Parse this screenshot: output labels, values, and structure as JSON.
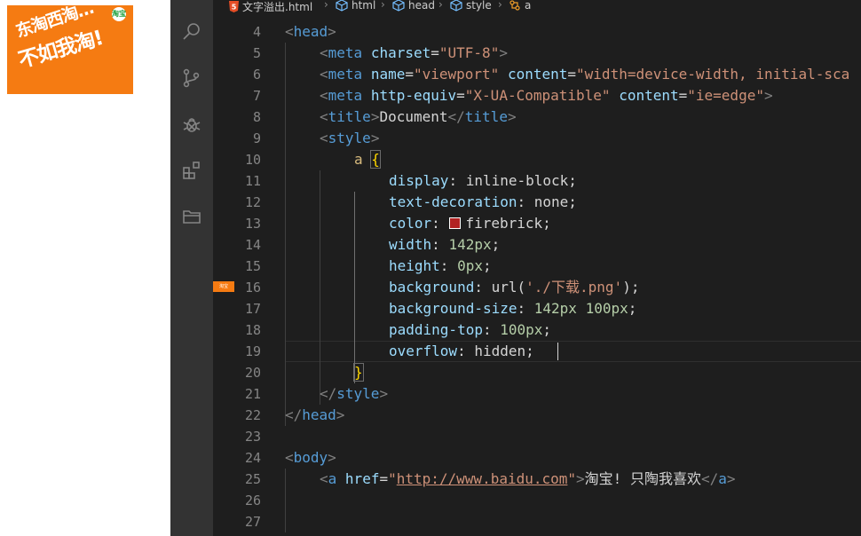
{
  "preview": {
    "logo_line1": "东淘西淘…",
    "logo_line2": "不如我淘!",
    "logo_badge": "淘宝"
  },
  "activity_bar": {
    "icons": [
      "search-icon",
      "source-control-icon",
      "debug-icon",
      "extensions-icon",
      "explorer-icon"
    ]
  },
  "breadcrumb": {
    "file": "文字溢出.html",
    "items": [
      "html",
      "head",
      "style",
      "a"
    ]
  },
  "gutter_thumbnail": "淘宝",
  "colors": {
    "swatch": "#b22222",
    "logo_bg": "#f57b12",
    "editor_bg": "#1e1e1e",
    "activity_bg": "#333333"
  },
  "editor": {
    "line_numbers": [
      "4",
      "5",
      "6",
      "7",
      "8",
      "9",
      "10",
      "11",
      "12",
      "13",
      "14",
      "15",
      "16",
      "17",
      "18",
      "19",
      "20",
      "21",
      "22",
      "23",
      "24",
      "25",
      "26",
      "27"
    ],
    "code": {
      "l4": [
        "<",
        "head",
        ">"
      ],
      "l5": [
        "<",
        "meta",
        " ",
        "charset",
        "=",
        "\"UTF-8\"",
        ">"
      ],
      "l6": [
        "<",
        "meta",
        " ",
        "name",
        "=",
        "\"viewport\"",
        " ",
        "content",
        "=",
        "\"width=device-width, initial-sca"
      ],
      "l7": [
        "<",
        "meta",
        " ",
        "http-equiv",
        "=",
        "\"X-UA-Compatible\"",
        " ",
        "content",
        "=",
        "\"ie=edge\"",
        ">"
      ],
      "l8": [
        "<",
        "title",
        ">",
        "Document",
        "</",
        "title",
        ">"
      ],
      "l9": [
        "<",
        "style",
        ">"
      ],
      "l10": [
        "a",
        " ",
        "{"
      ],
      "l11": [
        "display",
        ": ",
        "inline-block",
        ";"
      ],
      "l12": [
        "text-decoration",
        ": ",
        "none",
        ";"
      ],
      "l13": [
        "color",
        ": ",
        "firebrick",
        ";"
      ],
      "l14": [
        "width",
        ": ",
        "142px",
        ";"
      ],
      "l15": [
        "height",
        ": ",
        "0px",
        ";"
      ],
      "l16": [
        "background",
        ": ",
        "url(",
        "'./下载.png'",
        ");"
      ],
      "l17": [
        "background-size",
        ": ",
        "142px 100px",
        ";"
      ],
      "l18": [
        "padding-top",
        ": ",
        "100px",
        ";"
      ],
      "l19": [
        "overflow",
        ": ",
        "hidden",
        ";"
      ],
      "l20": [
        "}"
      ],
      "l21": [
        "</",
        "style",
        ">"
      ],
      "l22": [
        "</",
        "head",
        ">"
      ],
      "l24": [
        "<",
        "body",
        ">"
      ],
      "l25": [
        "<",
        "a",
        " ",
        "href",
        "=",
        "\"",
        "http://www.baidu.com",
        "\"",
        ">",
        "淘宝! 只陶我喜欢",
        "</",
        "a",
        ">"
      ]
    }
  }
}
